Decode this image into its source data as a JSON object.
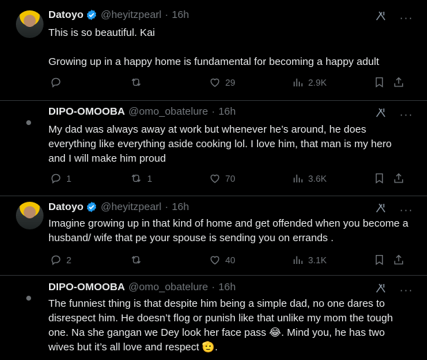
{
  "tweets": [
    {
      "name": "Datoyo",
      "verified": true,
      "handle": "@heyitzpearl",
      "time": "16h",
      "text": "This is so beautiful. Kai\n\nGrowing up in a happy home is fundamental for becoming a happy adult",
      "replies": "",
      "reposts": "",
      "likes": "29",
      "views": "2.9K"
    },
    {
      "name": "DIPO-OMOOBA",
      "verified": false,
      "handle": "@omo_obatelure",
      "time": "16h",
      "text": "My dad was always away at work but whenever he’s around, he does everything like everything aside cooking lol. I love him, that man is my hero and I will make him proud",
      "replies": "1",
      "reposts": "1",
      "likes": "70",
      "views": "3.6K"
    },
    {
      "name": "Datoyo",
      "verified": true,
      "handle": "@heyitzpearl",
      "time": "16h",
      "text": "Imagine growing up in that kind of home and get offended when you become a husband/ wife that pe your spouse is sending you on errands .",
      "replies": "2",
      "reposts": "",
      "likes": "40",
      "views": "3.1K"
    },
    {
      "name": "DIPO-OMOOBA",
      "verified": false,
      "handle": "@omo_obatelure",
      "time": "16h",
      "text_part1": "The funniest thing is that despite him being a simple dad, no one dares to disrespect him. He doesn’t flog or punish like that unlike my mom the tough one. Na she gangan we Dey look her face pass ",
      "emoji1": "😂",
      "text_part2": ". Mind you, he has two wives but it’s all love and respect ",
      "emoji2": "🫡",
      "text_part3": "."
    }
  ],
  "ui": {
    "dot": "·",
    "more_label": "···",
    "icons": [
      "reply-icon",
      "repost-icon",
      "like-icon",
      "views-icon",
      "bookmark-icon",
      "share-icon",
      "grok-icon",
      "verified-badge-icon"
    ],
    "accent": "#1d9bf0",
    "muted": "#71767b",
    "divider": "#2f3336"
  }
}
